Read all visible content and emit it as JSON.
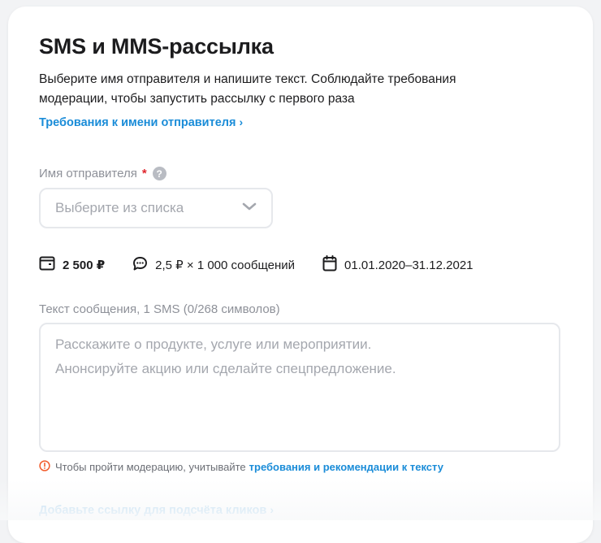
{
  "form": {
    "title": "SMS и MMS-рассылка",
    "description": "Выберите имя отправителя и напишите текст. Соблюдайте требования модерации, чтобы запустить рассылку с первого раза",
    "sender_requirements_link": "Требования к имени отправителя",
    "sender": {
      "label": "Имя отправителя",
      "required_mark": "*",
      "help_icon": "question-icon",
      "placeholder": "Выберите из списка",
      "value": ""
    },
    "stats": {
      "budget": "2 500 ₽",
      "rate": "2,5 ₽ × 1 000 сообщений",
      "period": "01.01.2020–31.12.2021"
    },
    "message": {
      "label": "Текст сообщения, 1 SMS (0/268 символов)",
      "placeholder_line1": "Расскажите о продукте, услуге или мероприятии.",
      "placeholder_line2": "Анонсируйте акцию или сделайте спецпредложение.",
      "value": ""
    },
    "moderation": {
      "text": "Чтобы пройти модерацию, учитывайте",
      "link": "требования и рекомендации к тексту"
    },
    "add_link": "Добавьте ссылку для подсчёта кликов"
  },
  "colors": {
    "accent": "#1a8cd8",
    "required": "#e0262d",
    "warning": "#f25c2c",
    "muted": "#8e9199"
  }
}
